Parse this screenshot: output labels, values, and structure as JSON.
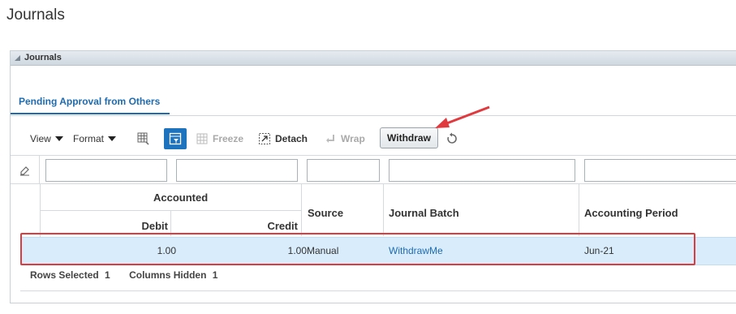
{
  "page": {
    "title": "Journals"
  },
  "panel": {
    "title": "Journals"
  },
  "tabs": [
    {
      "label": "Pending Approval from Others",
      "active": true
    }
  ],
  "toolbar": {
    "view_label": "View",
    "format_label": "Format",
    "freeze_label": "Freeze",
    "detach_label": "Detach",
    "wrap_label": "Wrap",
    "withdraw_label": "Withdraw"
  },
  "table": {
    "group_header": "Accounted",
    "columns": [
      "Debit",
      "Credit",
      "Source",
      "Journal Batch",
      "Accounting Period"
    ],
    "rows": [
      {
        "debit": "1.00",
        "credit": "1.00",
        "source": "Manual",
        "journal_batch": "WithdrawMe",
        "accounting_period": "Jun-21",
        "selected": true
      }
    ]
  },
  "status": {
    "rows_selected_label": "Rows Selected",
    "rows_selected_value": "1",
    "columns_hidden_label": "Columns Hidden",
    "columns_hidden_value": "1"
  },
  "colors": {
    "accent": "#1e6bb0",
    "selection": "#d9ecfb",
    "annotation": "#e0393e"
  }
}
